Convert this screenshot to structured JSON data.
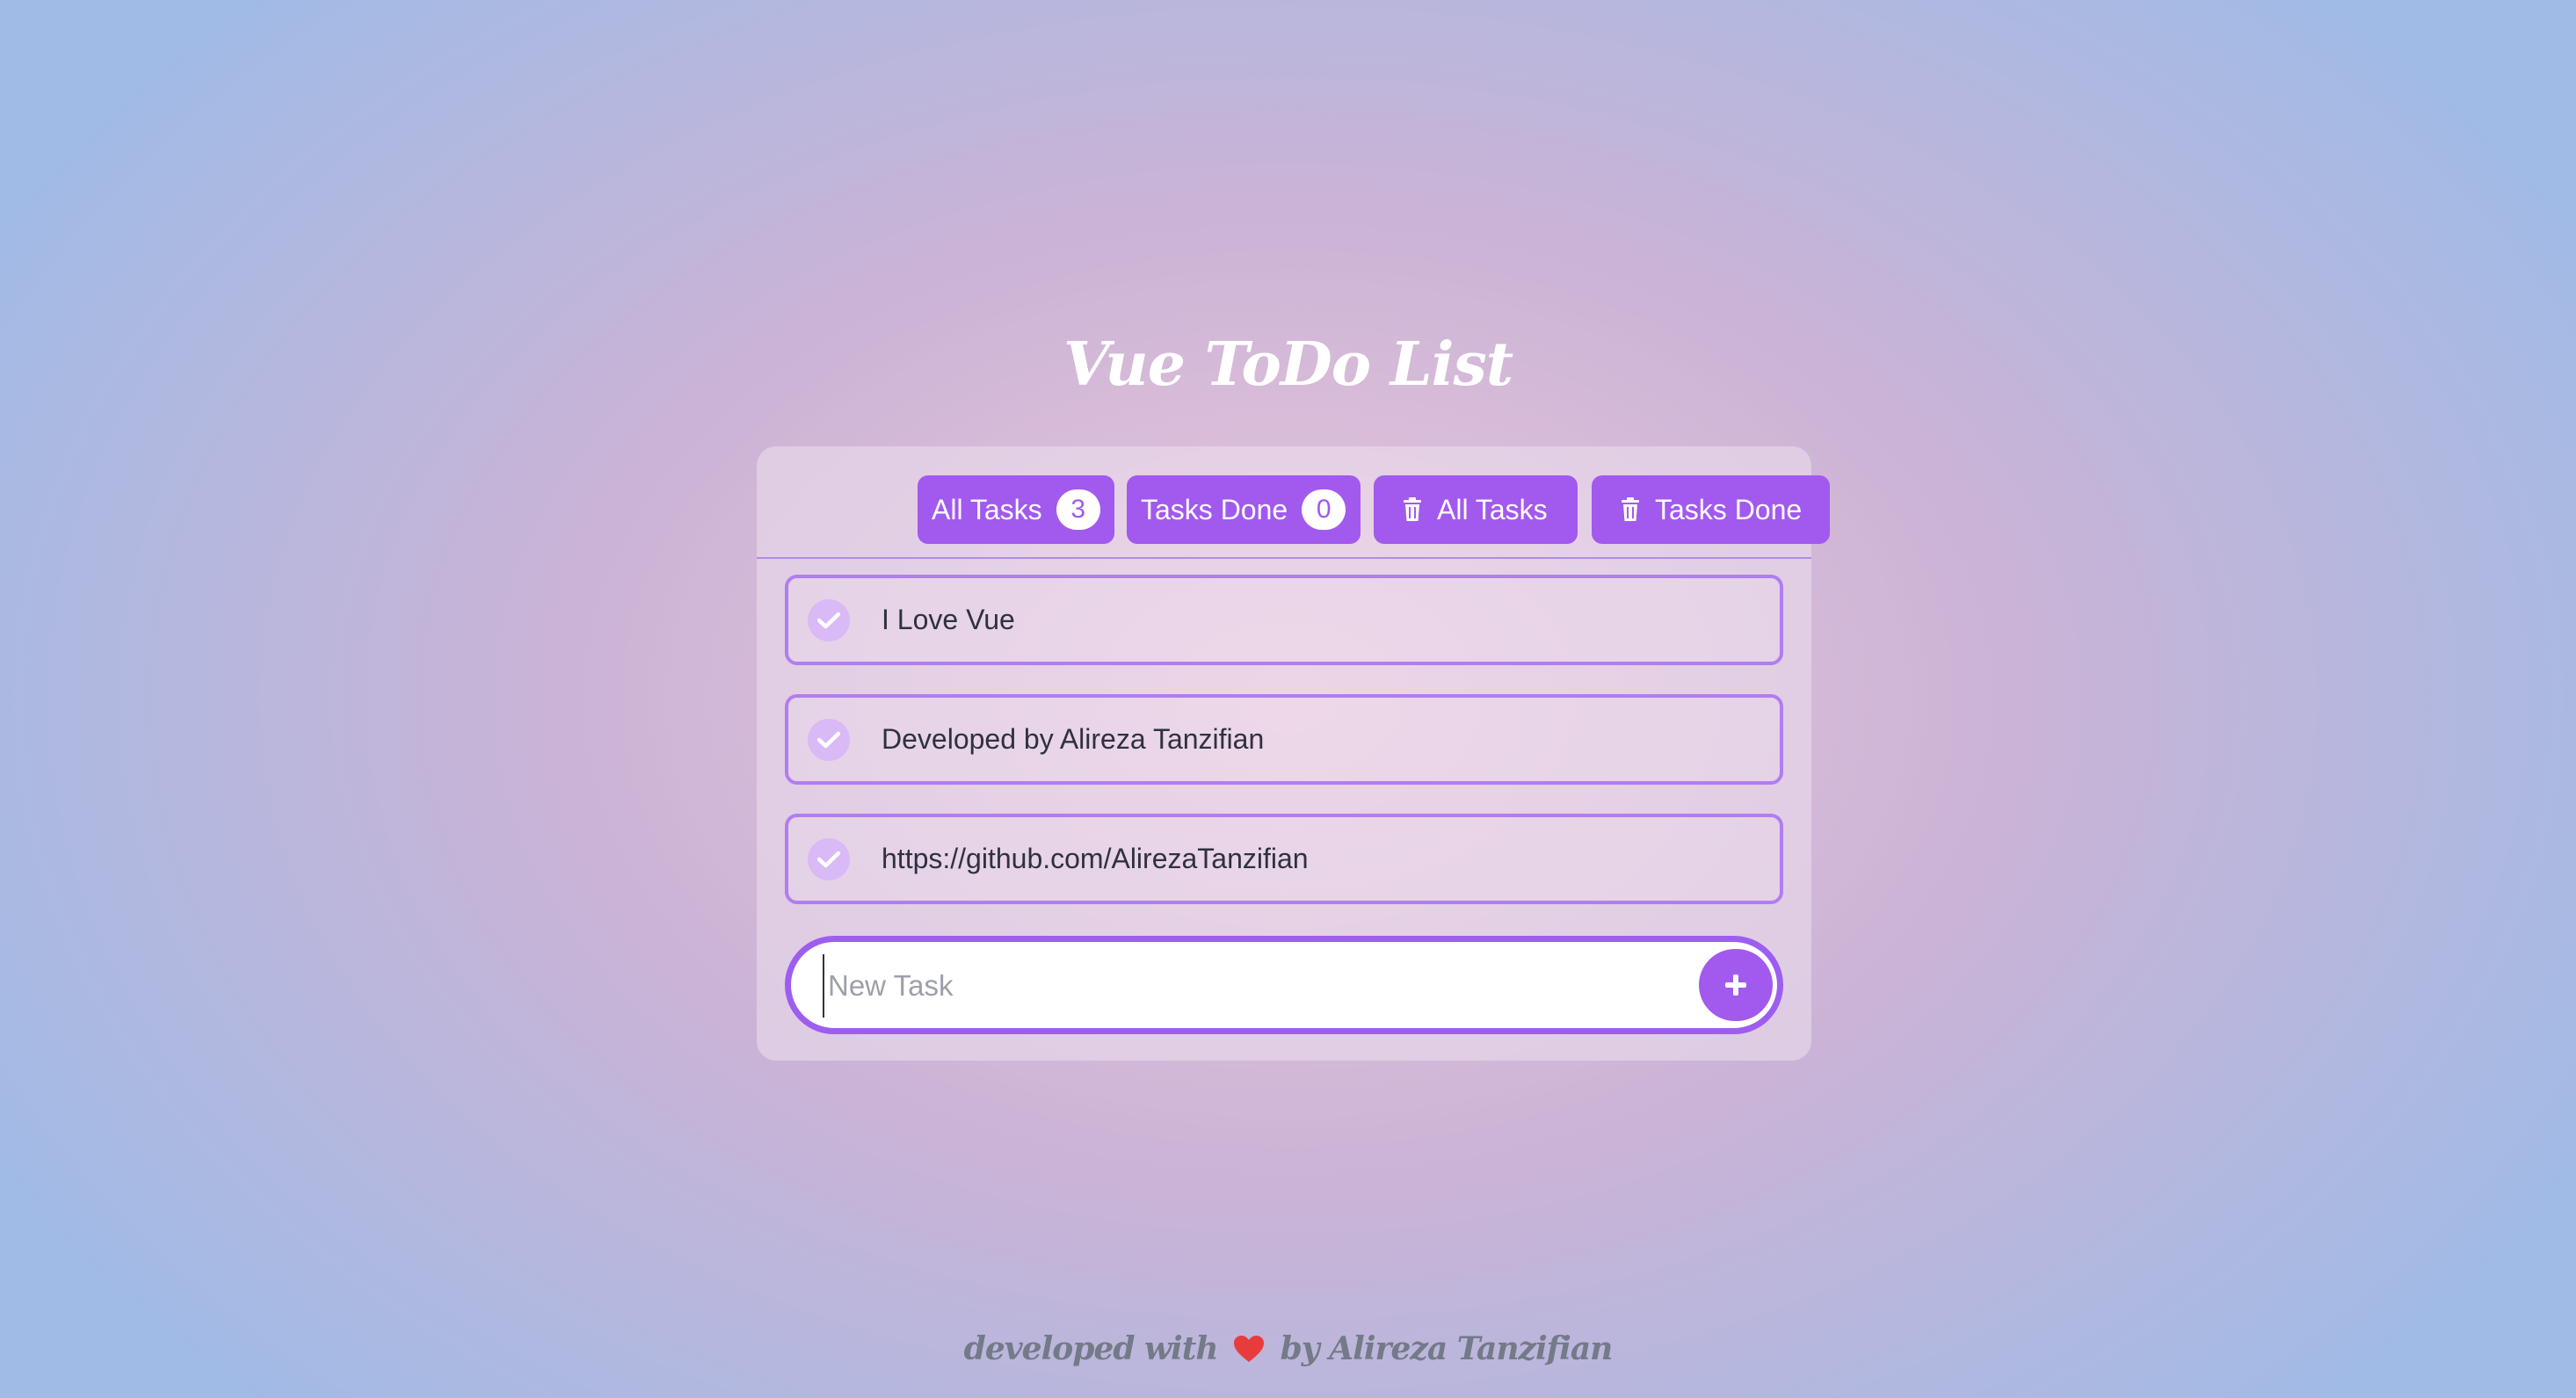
{
  "app": {
    "title": "Vue ToDo List"
  },
  "toolbar": {
    "all_tasks_label": "All Tasks",
    "all_tasks_count": "3",
    "tasks_done_label": "Tasks Done",
    "tasks_done_count": "0",
    "delete_all_label": "All Tasks",
    "delete_done_label": "Tasks Done"
  },
  "tasks": [
    {
      "text": "I Love Vue",
      "done": false
    },
    {
      "text": "Developed by Alireza Tanzifian",
      "done": false
    },
    {
      "text": "https://github.com/AlirezaTanzifian",
      "done": false
    }
  ],
  "new_task": {
    "placeholder": "New Task",
    "value": "",
    "add_icon": "plus-icon"
  },
  "footer": {
    "prefix": "developed with",
    "heart_icon": "heart-icon",
    "suffix": "by Alireza Tanzifian"
  },
  "colors": {
    "accent": "#a259ee",
    "task_border": "#b07eee",
    "heart": "#e83c3c"
  }
}
